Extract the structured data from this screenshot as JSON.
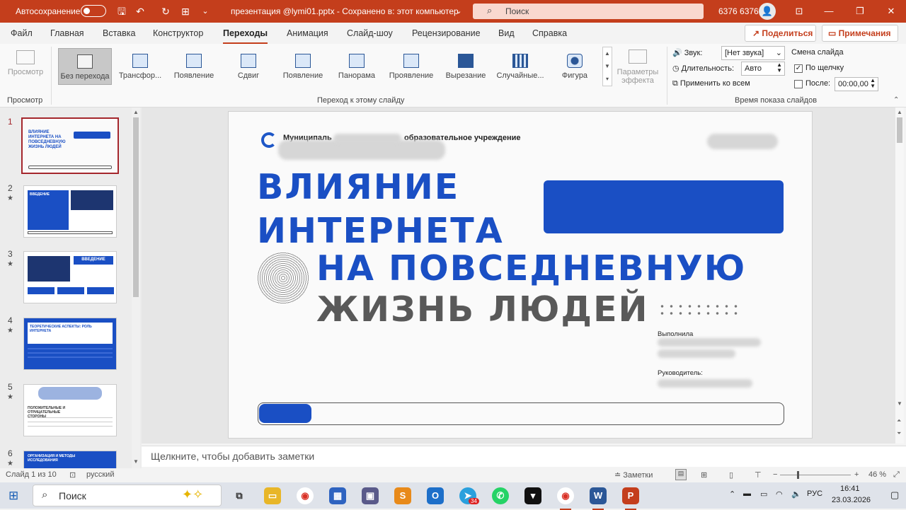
{
  "titlebar": {
    "autosave_label": "Автосохранение",
    "filename": "презентация @lymi01.pptx  -  Сохранено в: этот компьютер",
    "filename_caret": "⌄",
    "search_placeholder": "Поиск",
    "user": "6376 6376"
  },
  "menu": {
    "items": [
      "Файл",
      "Главная",
      "Вставка",
      "Конструктор",
      "Переходы",
      "Анимация",
      "Слайд-шоу",
      "Рецензирование",
      "Вид",
      "Справка"
    ],
    "active": "Переходы",
    "share": "Поделиться",
    "comments": "Примечания"
  },
  "ribbon": {
    "preview": {
      "label": "Просмотр",
      "group": "Просмотр"
    },
    "transitions": [
      "Без перехода",
      "Трансфор...",
      "Появление",
      "Сдвиг",
      "Появление",
      "Панорама",
      "Проявление",
      "Вырезание",
      "Случайные...",
      "Фигура"
    ],
    "effect_options": "Параметры эффекта",
    "transition_group": "Переход к этому слайду",
    "sound_label": "Звук:",
    "sound_value": "[Нет звука]",
    "duration_label": "Длительность:",
    "duration_value": "Авто",
    "apply_all": "Применить ко всем",
    "advance_label": "Смена слайда",
    "on_click": "По щелчку",
    "after_label": "После:",
    "after_value": "00:00,00",
    "timing_group": "Время показа слайдов"
  },
  "slides": {
    "numbers": [
      "1",
      "2",
      "3",
      "4",
      "5",
      "6"
    ],
    "thumb_titles": [
      "ВЛИЯНИЕ ИНТЕРНЕТА НА ПОВСЕДНЕВНУЮ ЖИЗНЬ ЛЮДЕЙ",
      "ВВЕДЕНИЕ",
      "ВВЕДЕНИЕ",
      "ТЕОРЕТИЧЕСКИЕ АСПЕКТЫ: РОЛЬ ИНТЕРНЕТА",
      "ПОЛОЖИТЕЛЬНЫЕ И ОТРИЦАТЕЛЬНЫЕ СТОРОНЫ",
      "ОРГАНИЗАЦИЯ И МЕТОДЫ ИССЛЕДОВАНИЯ"
    ]
  },
  "slide": {
    "org_a": "Муниципаль",
    "org_b": "образовательное учреждение",
    "title_line1": "ВЛИЯНИЕ",
    "title_line2": "ИНТЕРНЕТА",
    "title_line3": "НА ПОВСЕДНЕВНУЮ",
    "title_line4": "ЖИЗНЬ ЛЮДЕЙ",
    "performed_by": "Выполнила",
    "supervisor": "Руководитель:",
    "progress": 0.1
  },
  "notes_placeholder": "Щелкните, чтобы добавить заметки",
  "status": {
    "slide": "Слайд 1 из 10",
    "language": "русский",
    "notes": "Заметки",
    "zoom": "46 %"
  },
  "taskbar": {
    "search": "Поиск",
    "lang": "РУС",
    "time": "16:41",
    "date": "23.03.2026",
    "badge": "34"
  },
  "colors": {
    "brand": "#c43e1c",
    "slide_blue": "#1a4fc4"
  }
}
